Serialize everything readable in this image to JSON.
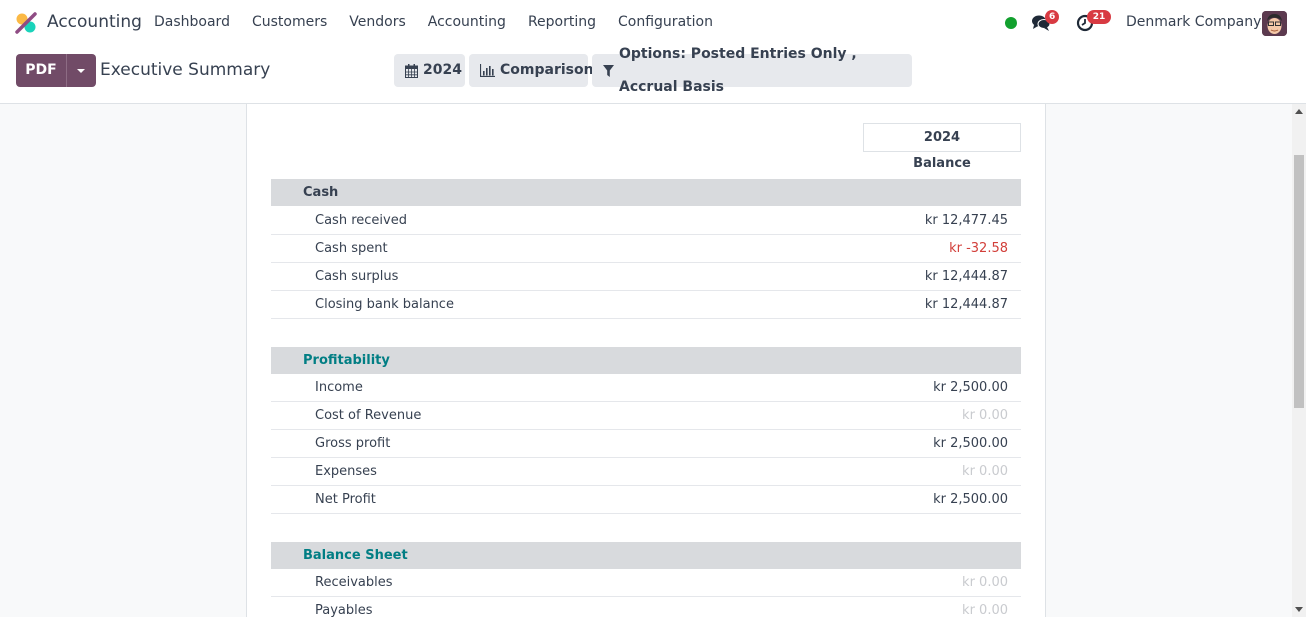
{
  "navbar": {
    "app_name": "Accounting",
    "menu": [
      "Dashboard",
      "Customers",
      "Vendors",
      "Accounting",
      "Reporting",
      "Configuration"
    ],
    "chat_count": "6",
    "activity_count": "21",
    "company": "Denmark Company",
    "presence_color": "#12a02e"
  },
  "control_panel": {
    "pdf_label": "PDF",
    "title": "Executive Summary",
    "date_filter": "2024",
    "comparison_label": "Comparison",
    "options_label": "Options: Posted Entries Only , Accrual Basis"
  },
  "report": {
    "column_year": "2024",
    "column_label": "Balance",
    "sections": [
      {
        "title": "Cash",
        "rows": [
          {
            "label": "Cash received",
            "value": "kr 12,477.45",
            "style": "normal"
          },
          {
            "label": "Cash spent",
            "value": "kr -32.58",
            "style": "negative"
          },
          {
            "label": "Cash surplus",
            "value": "kr 12,444.87",
            "style": "normal"
          },
          {
            "label": "Closing bank balance",
            "value": "kr 12,444.87",
            "style": "normal"
          }
        ]
      },
      {
        "title": "Profitability",
        "rows": [
          {
            "label": "Income",
            "value": "kr 2,500.00",
            "style": "normal"
          },
          {
            "label": "Cost of Revenue",
            "value": "kr 0.00",
            "style": "zero"
          },
          {
            "label": "Gross profit",
            "value": "kr 2,500.00",
            "style": "normal"
          },
          {
            "label": "Expenses",
            "value": "kr 0.00",
            "style": "zero"
          },
          {
            "label": "Net Profit",
            "value": "kr 2,500.00",
            "style": "normal"
          }
        ]
      },
      {
        "title": "Balance Sheet",
        "rows": [
          {
            "label": "Receivables",
            "value": "kr 0.00",
            "style": "zero"
          },
          {
            "label": "Payables",
            "value": "kr 0.00",
            "style": "zero"
          }
        ]
      }
    ]
  },
  "colors": {
    "brand": "#714b67",
    "negative": "#d23f3a",
    "section_accent": "#017e84",
    "badge": "#d83a42"
  }
}
